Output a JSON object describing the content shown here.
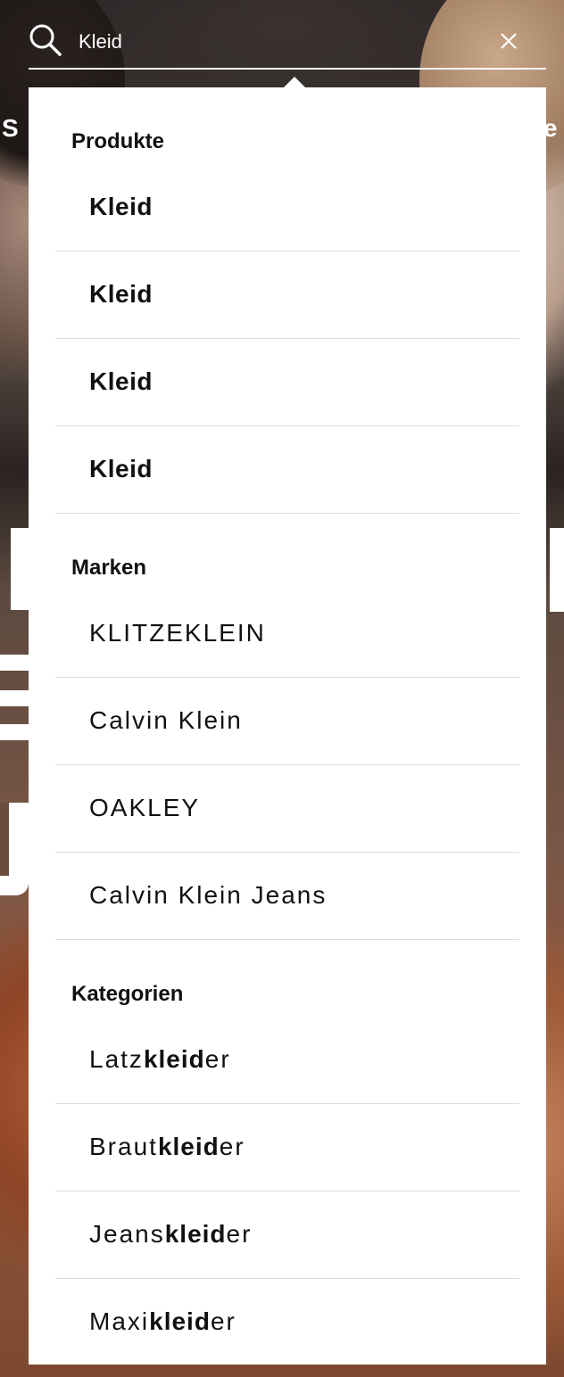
{
  "search": {
    "value": "Kleid",
    "icon": "search-icon",
    "clear_icon": "close-icon"
  },
  "background": {
    "left_letter": "S",
    "right_letters": "re"
  },
  "suggestions": {
    "products": {
      "heading": "Produkte",
      "items": [
        "Kleid",
        "Kleid",
        "Kleid",
        "Kleid"
      ]
    },
    "brands": {
      "heading": "Marken",
      "items": [
        "KLITZEKLEIN",
        "Calvin Klein",
        "OAKLEY",
        "Calvin Klein Jeans"
      ]
    },
    "categories": {
      "heading": "Kategorien",
      "items": [
        {
          "prefix": "Latz",
          "match": "kleid",
          "suffix": "er"
        },
        {
          "prefix": "Braut",
          "match": "kleid",
          "suffix": "er"
        },
        {
          "prefix": "Jeans",
          "match": "kleid",
          "suffix": "er"
        },
        {
          "prefix": "Maxi",
          "match": "kleid",
          "suffix": "er"
        }
      ]
    }
  },
  "colors": {
    "panel_background": "#ffffff",
    "text": "#111111",
    "divider": "#dcdcdc",
    "search_foreground": "#ffffff"
  }
}
